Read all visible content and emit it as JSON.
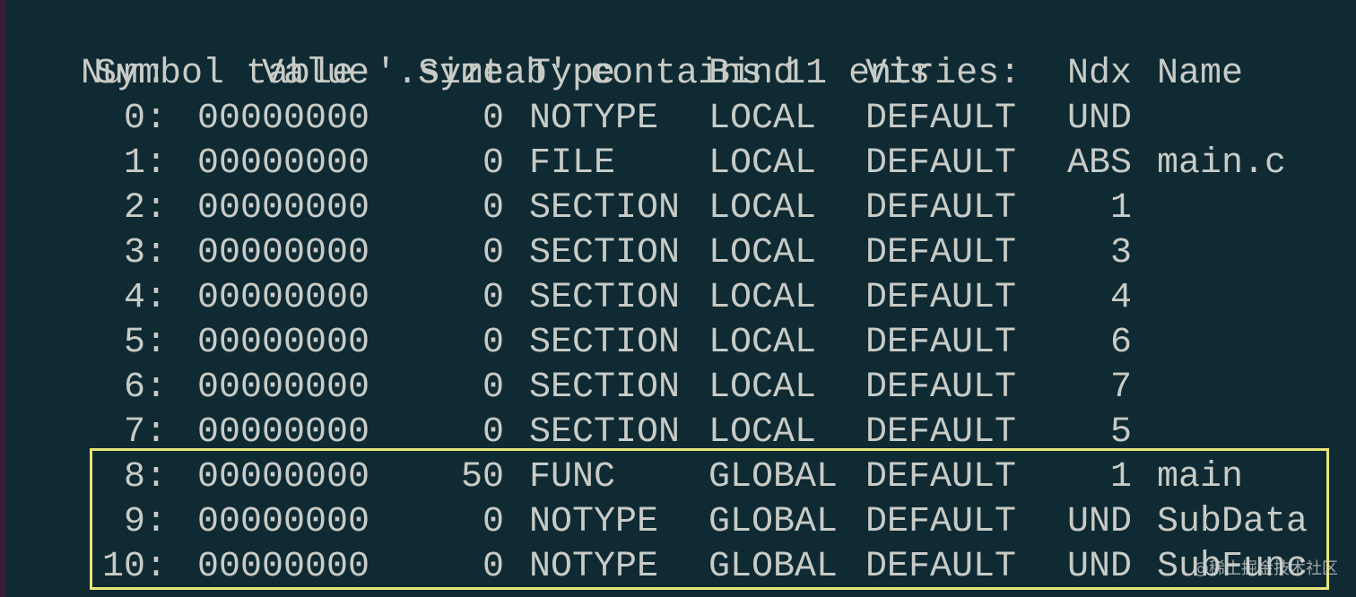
{
  "terminal": {
    "title_line": "Symbol table '.symtab' contains 11 entries:",
    "headers": {
      "num": "Num:",
      "value": "Value",
      "size": "Size",
      "type": "Type",
      "bind": "Bind",
      "vis": "Vis",
      "ndx": "Ndx",
      "name": "Name"
    },
    "rows": [
      {
        "num": "0:",
        "value": "00000000",
        "size": "0",
        "type": "NOTYPE",
        "bind": "LOCAL",
        "vis": "DEFAULT",
        "ndx": "UND",
        "name": ""
      },
      {
        "num": "1:",
        "value": "00000000",
        "size": "0",
        "type": "FILE",
        "bind": "LOCAL",
        "vis": "DEFAULT",
        "ndx": "ABS",
        "name": "main.c"
      },
      {
        "num": "2:",
        "value": "00000000",
        "size": "0",
        "type": "SECTION",
        "bind": "LOCAL",
        "vis": "DEFAULT",
        "ndx": "1",
        "name": ""
      },
      {
        "num": "3:",
        "value": "00000000",
        "size": "0",
        "type": "SECTION",
        "bind": "LOCAL",
        "vis": "DEFAULT",
        "ndx": "3",
        "name": ""
      },
      {
        "num": "4:",
        "value": "00000000",
        "size": "0",
        "type": "SECTION",
        "bind": "LOCAL",
        "vis": "DEFAULT",
        "ndx": "4",
        "name": ""
      },
      {
        "num": "5:",
        "value": "00000000",
        "size": "0",
        "type": "SECTION",
        "bind": "LOCAL",
        "vis": "DEFAULT",
        "ndx": "6",
        "name": ""
      },
      {
        "num": "6:",
        "value": "00000000",
        "size": "0",
        "type": "SECTION",
        "bind": "LOCAL",
        "vis": "DEFAULT",
        "ndx": "7",
        "name": ""
      },
      {
        "num": "7:",
        "value": "00000000",
        "size": "0",
        "type": "SECTION",
        "bind": "LOCAL",
        "vis": "DEFAULT",
        "ndx": "5",
        "name": ""
      },
      {
        "num": "8:",
        "value": "00000000",
        "size": "50",
        "type": "FUNC",
        "bind": "GLOBAL",
        "vis": "DEFAULT",
        "ndx": "1",
        "name": "main"
      },
      {
        "num": "9:",
        "value": "00000000",
        "size": "0",
        "type": "NOTYPE",
        "bind": "GLOBAL",
        "vis": "DEFAULT",
        "ndx": "UND",
        "name": "SubData"
      },
      {
        "num": "10:",
        "value": "00000000",
        "size": "0",
        "type": "NOTYPE",
        "bind": "GLOBAL",
        "vis": "DEFAULT",
        "ndx": "UND",
        "name": "SubFunc"
      }
    ]
  },
  "watermark": "@稀土掘金技术社区",
  "colors": {
    "background": "#0f2a33",
    "text": "#c8cbc6",
    "highlight": "#e8e57a"
  }
}
